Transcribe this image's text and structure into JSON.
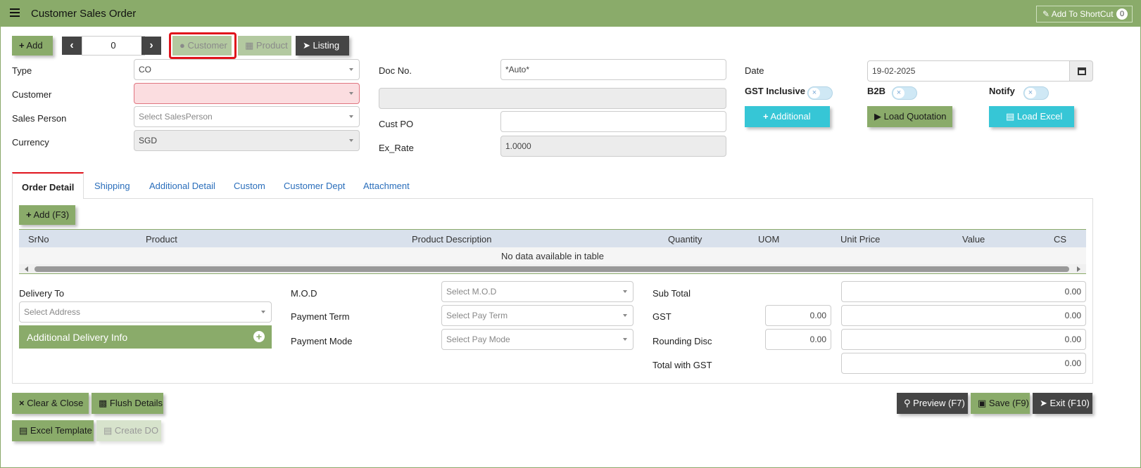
{
  "header": {
    "title": "Customer Sales Order",
    "shortcut_label": "Add To ShortCut",
    "shortcut_count": "0"
  },
  "toolbar": {
    "add_label": "Add",
    "record_index": "0",
    "customer_label": "Customer",
    "product_label": "Product",
    "listing_label": "Listing"
  },
  "form": {
    "type_label": "Type",
    "type_value": "CO",
    "customer_label": "Customer",
    "customer_value": "",
    "salesperson_label": "Sales Person",
    "salesperson_placeholder": "Select SalesPerson",
    "currency_label": "Currency",
    "currency_value": "SGD",
    "docno_label": "Doc No.",
    "docno_value": "*Auto*",
    "custpo_label": "Cust PO",
    "custpo_value": "",
    "exrate_label": "Ex_Rate",
    "exrate_value": "1.0000",
    "date_label": "Date",
    "date_value": "19-02-2025",
    "gst_inclusive_label": "GST Inclusive",
    "b2b_label": "B2B",
    "notify_label": "Notify",
    "additional_label": "Additional",
    "load_quotation_label": "Load Quotation",
    "load_excel_label": "Load Excel"
  },
  "tabs": [
    "Order Detail",
    "Shipping",
    "Additional Detail",
    "Custom",
    "Customer Dept",
    "Attachment"
  ],
  "order_table": {
    "add_label": "Add (F3)",
    "columns": [
      "SrNo",
      "Product",
      "Product Description",
      "Quantity",
      "UOM",
      "Unit Price",
      "Value",
      "CS"
    ],
    "empty_text": "No data available in table"
  },
  "delivery": {
    "label": "Delivery To",
    "address_placeholder": "Select Address",
    "additional_info_label": "Additional Delivery Info"
  },
  "payment": {
    "mod_label": "M.O.D",
    "mod_placeholder": "Select M.O.D",
    "term_label": "Payment Term",
    "term_placeholder": "Select Pay Term",
    "mode_label": "Payment Mode",
    "mode_placeholder": "Select Pay Mode"
  },
  "totals": {
    "subtotal_label": "Sub Total",
    "subtotal_value": "0.00",
    "gst_label": "GST",
    "gst_rate": "0.00",
    "gst_value": "0.00",
    "rounding_label": "Rounding Disc",
    "rounding_rate": "0.00",
    "rounding_value": "0.00",
    "total_label": "Total with GST",
    "total_value": "0.00"
  },
  "footer": {
    "clear_close_label": "Clear & Close",
    "flush_label": "Flush Details",
    "excel_template_label": "Excel Template",
    "create_do_label": "Create DO",
    "preview_label": "Preview (F7)",
    "save_label": "Save (F9)",
    "exit_label": "Exit (F10)"
  }
}
